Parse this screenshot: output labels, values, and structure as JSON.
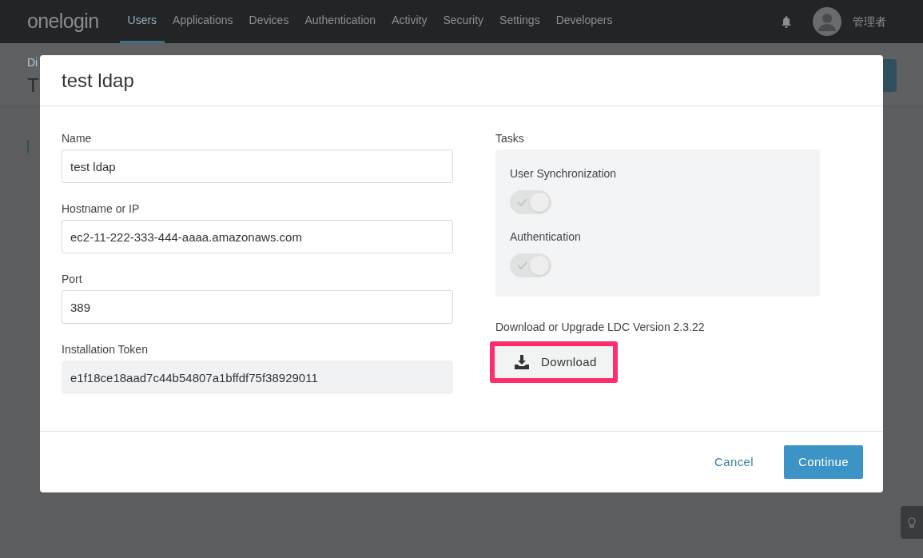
{
  "navbar": {
    "logo": "onelogin",
    "items": [
      {
        "label": "Users",
        "selected": true
      },
      {
        "label": "Applications",
        "selected": false
      },
      {
        "label": "Devices",
        "selected": false
      },
      {
        "label": "Authentication",
        "selected": false
      },
      {
        "label": "Activity",
        "selected": false
      },
      {
        "label": "Security",
        "selected": false
      },
      {
        "label": "Settings",
        "selected": false
      },
      {
        "label": "Developers",
        "selected": false
      }
    ],
    "user": "管理者"
  },
  "page": {
    "breadcrumb": "Di",
    "title": "T"
  },
  "dialog": {
    "title": "test ldap",
    "fields": [
      {
        "label": "Name",
        "value": "test ldap",
        "disabled": false
      },
      {
        "label": "Hostname or IP",
        "value": "ec2-11-222-333-444-aaaa.amazonaws.com",
        "disabled": false
      },
      {
        "label": "Port",
        "value": "389",
        "disabled": false
      },
      {
        "label": "Installation Token",
        "value": "e1f18ce18aad7c44b54807a1bffdf75f38929011",
        "disabled": true
      }
    ],
    "tasks_label": "Tasks",
    "tasks": [
      {
        "label": "User Synchronization",
        "on": true,
        "disabled": true
      },
      {
        "label": "Authentication",
        "on": true,
        "disabled": true
      }
    ],
    "download_label": "Download or Upgrade LDC Version 2.3.22",
    "download_button": {
      "label": "Download",
      "highlighted": true
    },
    "buttons": {
      "cancel": "Cancel",
      "continue": "Continue"
    }
  }
}
